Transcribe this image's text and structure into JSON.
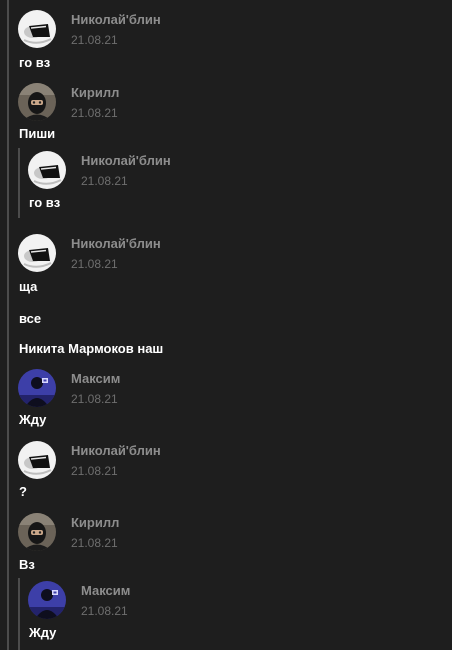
{
  "messages": [
    {
      "author": "Николай'блин",
      "date": "21.08.21",
      "avatar": "nikolai-avatar",
      "lines": [
        "го вз"
      ]
    },
    {
      "author": "Кирилл",
      "date": "21.08.21",
      "avatar": "kirill-avatar",
      "lines": [
        "Пиши"
      ],
      "reply": {
        "author": "Николай'блин",
        "date": "21.08.21",
        "avatar": "nikolai-avatar",
        "lines": [
          "го вз"
        ]
      }
    },
    {
      "author": "Николай'блин",
      "date": "21.08.21",
      "avatar": "nikolai-avatar",
      "lines": [
        "ща",
        "все",
        "Никита Мармоков наш"
      ]
    },
    {
      "author": "Максим",
      "date": "21.08.21",
      "avatar": "maksim-avatar",
      "lines": [
        "Жду"
      ]
    },
    {
      "author": "Николай'блин",
      "date": "21.08.21",
      "avatar": "nikolai-avatar",
      "lines": [
        "?"
      ]
    },
    {
      "author": "Кирилл",
      "date": "21.08.21",
      "avatar": "kirill-avatar",
      "lines": [
        "Вз"
      ],
      "reply": {
        "author": "Максим",
        "date": "21.08.21",
        "avatar": "maksim-avatar",
        "lines": [
          "Жду"
        ]
      }
    }
  ],
  "colors": {
    "background": "#1e1e1e",
    "author": "#8d8d8d",
    "date": "#6e6e6e",
    "text": "#ffffff",
    "thread_line": "#4c4c4c"
  }
}
